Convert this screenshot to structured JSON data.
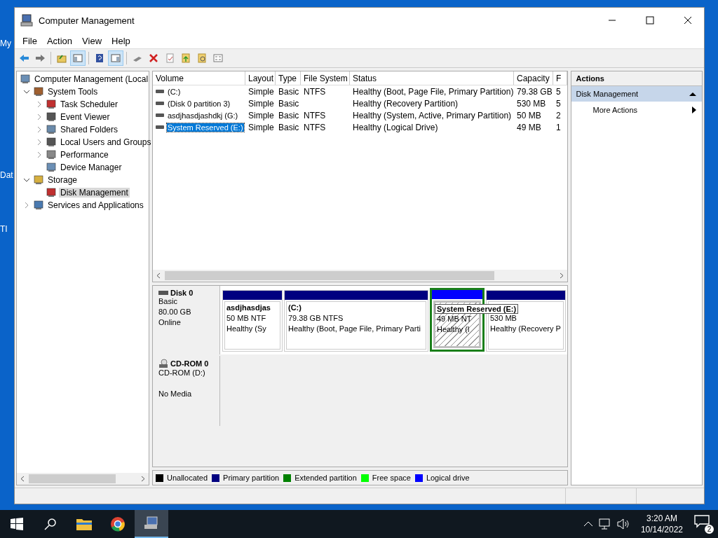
{
  "desktop_icons": [
    {
      "label": "My"
    },
    {
      "label": "Dat"
    },
    {
      "label": "TI"
    }
  ],
  "window": {
    "title": "Computer Management"
  },
  "menu": [
    "File",
    "Action",
    "View",
    "Help"
  ],
  "toolbar": [
    {
      "pressed": false
    },
    {
      "pressed": false
    },
    {
      "pressed": false
    },
    {
      "pressed": true
    },
    {
      "pressed": false
    },
    {
      "pressed": true
    },
    {
      "pressed": false
    },
    {
      "pressed": false
    },
    {
      "pressed": false
    },
    {
      "pressed": false
    },
    {
      "pressed": false
    },
    {
      "pressed": false
    }
  ],
  "tree": [
    {
      "label": "Computer Management (Local",
      "selected": false,
      "children": [
        {
          "label": "System Tools",
          "expanded": true,
          "selected": false,
          "children": [
            {
              "label": "Task Scheduler",
              "expanded": false,
              "selected": false
            },
            {
              "label": "Event Viewer",
              "expanded": false,
              "selected": false
            },
            {
              "label": "Shared Folders",
              "expanded": false,
              "selected": false
            },
            {
              "label": "Local Users and Groups",
              "expanded": false,
              "selected": false
            },
            {
              "label": "Performance",
              "expanded": false,
              "selected": false
            },
            {
              "label": "Device Manager",
              "selected": false
            }
          ]
        },
        {
          "label": "Storage",
          "expanded": true,
          "selected": false,
          "children": [
            {
              "label": "Disk Management",
              "selected": true
            }
          ]
        },
        {
          "label": "Services and Applications",
          "expanded": false,
          "selected": false
        }
      ]
    }
  ],
  "table": {
    "columns": [
      "Volume",
      "Layout",
      "Type",
      "File System",
      "Status",
      "Capacity",
      "F"
    ],
    "rows": [
      {
        "selected": false,
        "cells": [
          "(C:)",
          "Simple",
          "Basic",
          "NTFS",
          "Healthy (Boot, Page File, Primary Partition)",
          "79.38 GB",
          "5"
        ]
      },
      {
        "selected": false,
        "cells": [
          "(Disk 0 partition 3)",
          "Simple",
          "Basic",
          "",
          "Healthy (Recovery Partition)",
          "530 MB",
          "5"
        ]
      },
      {
        "selected": false,
        "cells": [
          "asdjhasdjashdkj (G:)",
          "Simple",
          "Basic",
          "NTFS",
          "Healthy (System, Active, Primary Partition)",
          "50 MB",
          "2"
        ]
      },
      {
        "selected": true,
        "cells": [
          "System Reserved (E:)",
          "Simple",
          "Basic",
          "NTFS",
          "Healthy (Logical Drive)",
          "49 MB",
          "1"
        ]
      }
    ]
  },
  "disks": [
    {
      "name": "Disk 0",
      "kind": "disk",
      "lines": [
        "Basic",
        "80.00 GB",
        "Online"
      ],
      "partitions": [
        {
          "kind": "primary",
          "label": "asdjhasdjas",
          "size": "50 MB NTF",
          "status": "Healthy (Sy",
          "selected": false
        },
        {
          "kind": "primary",
          "label": "(C:)",
          "size": "79.38 GB NTFS",
          "status": "Healthy (Boot, Page File, Primary Parti",
          "selected": false
        },
        {
          "kind": "logical",
          "size": "49 MB NT",
          "status": "Healthy (l",
          "selected": true
        },
        {
          "kind": "primary",
          "size": "530 MB",
          "status": "Healthy (Recovery P",
          "selected": false
        }
      ]
    },
    {
      "name": "CD-ROM 0",
      "kind": "cdrom",
      "lines": [
        "CD-ROM (D:)",
        "No Media"
      ]
    }
  ],
  "tooltip": "System Reserved  (E:)",
  "legend": [
    {
      "label": "Unallocated",
      "color": "#000000"
    },
    {
      "label": "Primary partition",
      "color": "#000080"
    },
    {
      "label": "Extended partition",
      "color": "#008000"
    },
    {
      "label": "Free space",
      "color": "#00ff00"
    },
    {
      "label": "Logical drive",
      "color": "#0000ff"
    }
  ],
  "actions": {
    "title": "Actions",
    "sections": [
      {
        "label": "Disk Management",
        "expanded": true,
        "items": [
          "More Actions"
        ]
      }
    ]
  },
  "taskbar": {
    "apps": [
      {
        "selected": false
      },
      {
        "selected": false
      },
      {
        "selected": false
      },
      {
        "selected": false
      },
      {
        "selected": true
      }
    ],
    "time": "3:20 AM",
    "date": "10/14/2022",
    "notifications": "2"
  }
}
